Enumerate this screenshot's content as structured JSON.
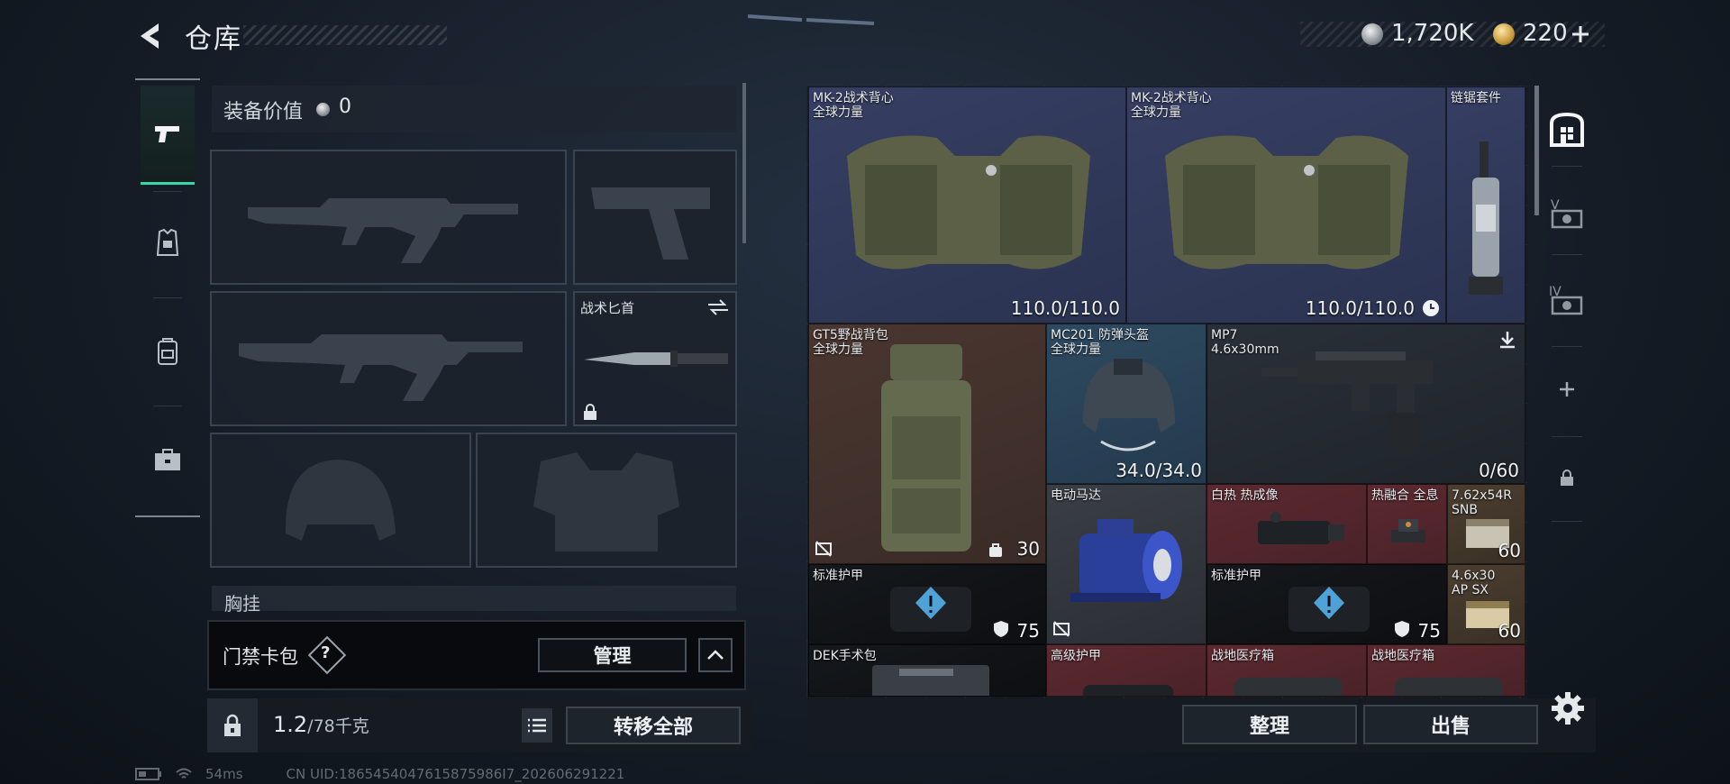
{
  "header": {
    "title": "仓库",
    "currency_silver": "1,720K",
    "currency_gold": "220"
  },
  "equipment": {
    "value_label": "装备价值",
    "value": "0",
    "knife_label": "战术匕首",
    "chest_label": "胸挂"
  },
  "keycard": {
    "label": "门禁卡包",
    "help": "?",
    "manage_label": "管理"
  },
  "capacity": {
    "current": "1.2",
    "max": "/78千克",
    "transfer_all_label": "转移全部"
  },
  "items": [
    {
      "name": "MK-2战术背心",
      "sub": "全球力量",
      "value": "110.0/110.0"
    },
    {
      "name": "MK-2战术背心",
      "sub": "全球力量",
      "value": "110.0/110.0"
    },
    {
      "name": "链锯套件"
    },
    {
      "name": "GT5野战背包",
      "sub": "全球力量",
      "value": "30"
    },
    {
      "name": "MC201 防弹头盔",
      "sub": "全球力量",
      "value": "34.0/34.0"
    },
    {
      "name": "MP7",
      "sub": "4.6x30mm",
      "value": "0/60"
    },
    {
      "name": "电动马达"
    },
    {
      "name": "白热 热成像"
    },
    {
      "name": "热融合 全息"
    },
    {
      "name": "7.62x54R",
      "sub": "SNB",
      "value": "60"
    },
    {
      "name": "标准护甲",
      "value": "75"
    },
    {
      "name": "标准护甲",
      "value": "75"
    },
    {
      "name": "4.6x30",
      "sub": "AP SX",
      "value": "60"
    },
    {
      "name": "DEK手术包"
    },
    {
      "name": "高级护甲"
    },
    {
      "name": "战地医疗箱"
    },
    {
      "name": "战地医疗箱"
    }
  ],
  "actions": {
    "sort_label": "整理",
    "sell_label": "出售"
  },
  "status": {
    "ping": "54ms",
    "uid": "CN UID:1865454047615875986I7_202606291221"
  },
  "colors": {
    "accent": "#39d6a9",
    "cell_blue": "#363f63",
    "cell_red": "#5b2a30"
  }
}
